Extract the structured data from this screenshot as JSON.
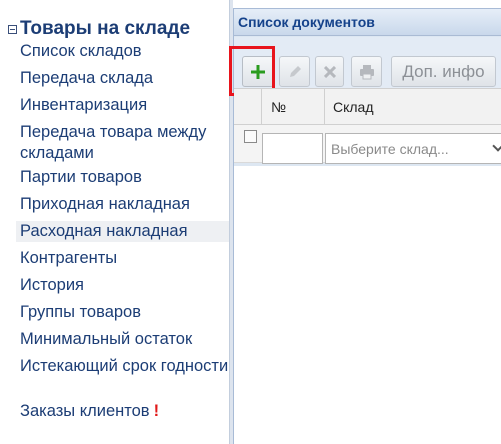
{
  "nav": {
    "title": "Товары на складе",
    "items": [
      {
        "label": "Список складов"
      },
      {
        "label": "Передача склада"
      },
      {
        "label": "Инвентаризация"
      },
      {
        "label": "Передача товара между складами"
      },
      {
        "label": "Партии товаров"
      },
      {
        "label": "Приходная накладная"
      },
      {
        "label": "Расходная накладная"
      },
      {
        "label": "Контрагенты"
      },
      {
        "label": "История"
      },
      {
        "label": "Группы товаров"
      },
      {
        "label": "Минимальный остаток"
      },
      {
        "label": "Истекающий срок годности"
      },
      {
        "label": "Заказы клиентов",
        "alert": "!"
      }
    ]
  },
  "documents": {
    "title": "Список документов",
    "toolbar": {
      "more_label": "Доп. инфо"
    },
    "columns": [
      {
        "label": "№"
      },
      {
        "label": "Склад"
      }
    ],
    "filter": {
      "sklad_placeholder": "Выберите склад..."
    }
  }
}
